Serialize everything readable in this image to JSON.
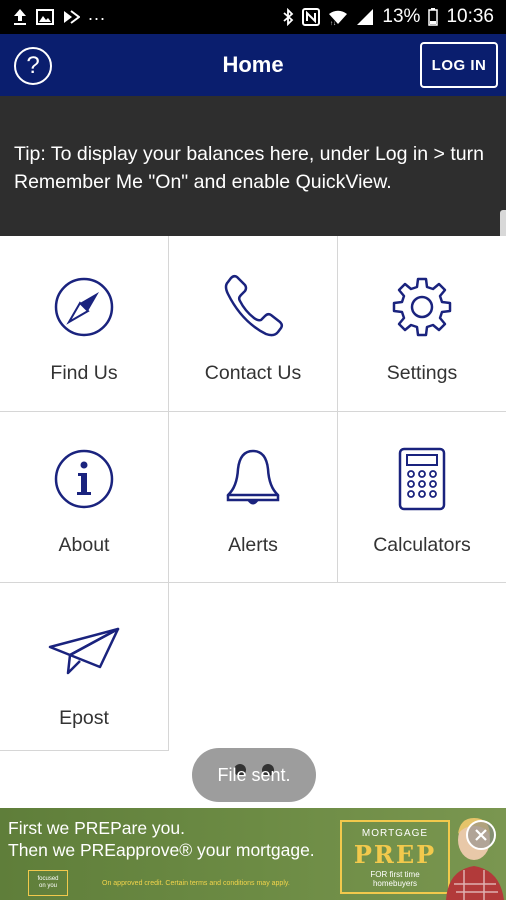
{
  "status_bar": {
    "battery_percent": "13%",
    "time": "10:36",
    "overflow": "...",
    "left_icons": [
      "upload-icon",
      "image-icon",
      "forward-notification-icon"
    ],
    "right_icons": [
      "bluetooth-icon",
      "nfc-icon",
      "wifi-icon",
      "signal-icon",
      "battery-icon"
    ]
  },
  "app_bar": {
    "help_label": "?",
    "title": "Home",
    "login_label": "LOG IN"
  },
  "tip": {
    "text": "Tip: To display your balances here, under Log in > turn Remember Me \"On\" and enable QuickView."
  },
  "tiles": [
    {
      "label": "Find Us",
      "icon": "compass-icon"
    },
    {
      "label": "Contact Us",
      "icon": "phone-icon"
    },
    {
      "label": "Settings",
      "icon": "gear-icon"
    },
    {
      "label": "About",
      "icon": "info-icon"
    },
    {
      "label": "Alerts",
      "icon": "bell-icon"
    },
    {
      "label": "Calculators",
      "icon": "calculator-icon"
    },
    {
      "label": "Epost",
      "icon": "paper-plane-icon"
    }
  ],
  "toast": {
    "text": "File sent."
  },
  "ad": {
    "line1": "First we PREPare you.",
    "line2": "Then we PREapprove® your mortgage.",
    "disclaimer": "On approved credit. Certain terms and conditions may apply.",
    "logo_text_1": "focused",
    "logo_text_2": "on you",
    "badge_top": "MORTGAGE",
    "badge_main": "PREP",
    "badge_sub_1": "FOR first time",
    "badge_sub_2": "homebuyers"
  },
  "colors": {
    "app_bar": "#0a1e6e",
    "icon_navy": "#1a237e",
    "tip_bg": "#2e2e2e",
    "ad_green": "#6c8b44",
    "badge_gold": "#f2c94c"
  }
}
